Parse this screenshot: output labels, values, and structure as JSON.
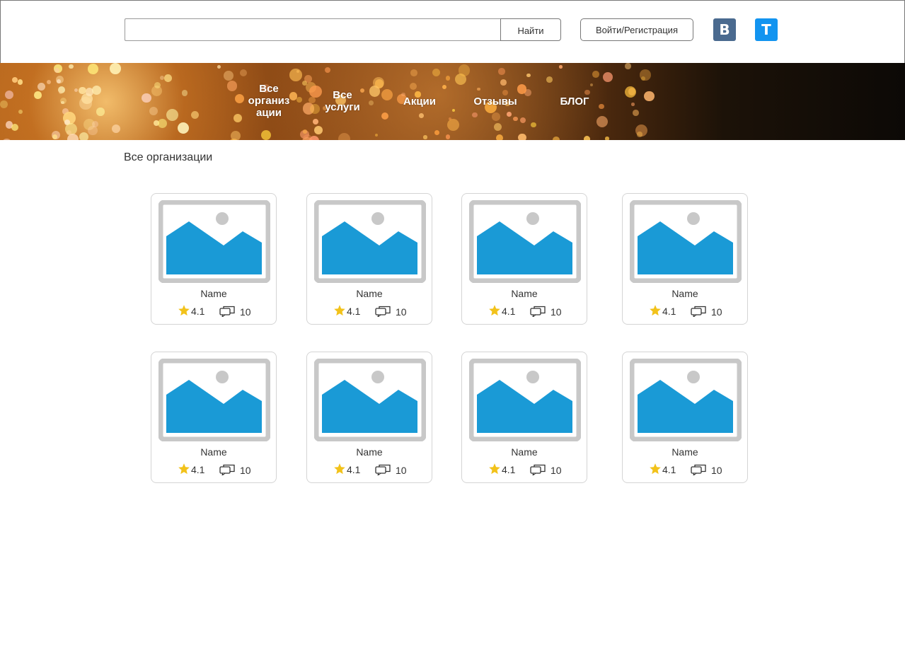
{
  "header": {
    "search": {
      "value": "",
      "placeholder": ""
    },
    "search_button_label": "Найти",
    "login_button_label": "Войти/Регистрация",
    "social": {
      "vk_label": "B",
      "telegram_label": "T"
    }
  },
  "nav": {
    "items": [
      {
        "label": "Все\nорганиз\nации"
      },
      {
        "label": "Все\nуслуги"
      },
      {
        "label": "Акции"
      },
      {
        "label": "Отзывы"
      },
      {
        "label": "БЛОГ"
      }
    ]
  },
  "page": {
    "title": "Все организации"
  },
  "colors": {
    "image_frame": "#c8c8c8",
    "image_mountains": "#1a9ad6",
    "star": "#f2c21a",
    "vk": "#4a6a8f",
    "telegram": "#1294f0"
  },
  "icons": {
    "placeholder": "image-placeholder-icon",
    "rating": "star-icon",
    "reviews": "comment-icon"
  },
  "cards": [
    {
      "name": "Name",
      "rating": "4.1",
      "reviews": "10"
    },
    {
      "name": "Name",
      "rating": "4.1",
      "reviews": "10"
    },
    {
      "name": "Name",
      "rating": "4.1",
      "reviews": "10"
    },
    {
      "name": "Name",
      "rating": "4.1",
      "reviews": "10"
    },
    {
      "name": "Name",
      "rating": "4.1",
      "reviews": "10"
    },
    {
      "name": "Name",
      "rating": "4.1",
      "reviews": "10"
    },
    {
      "name": "Name",
      "rating": "4.1",
      "reviews": "10"
    },
    {
      "name": "Name",
      "rating": "4.1",
      "reviews": "10"
    }
  ]
}
